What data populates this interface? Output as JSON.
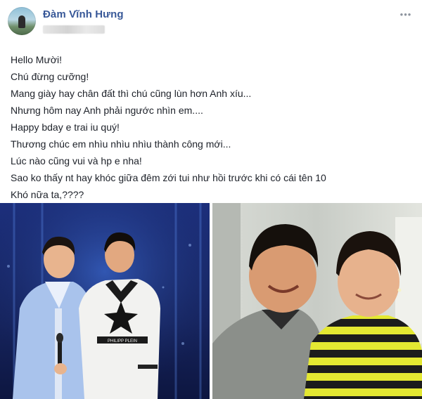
{
  "post": {
    "author": "Đàm Vĩnh Hưng",
    "more_icon": "more-horizontal-icon",
    "lines": [
      "Hello Mười!",
      "Chú đừng cưỡng!",
      "Mang giày hay chân đất thì chú cũng lùn hơn Anh xíu...",
      "Nhưng hôm nay Anh phải ngước nhìn em....",
      "Happy bday e trai iu quý!",
      "Thương chúc em nhìu nhìu nhìu thành công mới...",
      "Lúc nào cũng vui và hp e nha!",
      "Sao ko thấy nt hay khóc giữa đêm zới tui như hồi trước khi có cái tên 10",
      "Khó nữa ta,????"
    ],
    "photos": [
      {
        "shirt_text": "PHILIPP PLEIN"
      },
      {
        "shirt_text": ""
      }
    ]
  },
  "colors": {
    "author_blue": "#385898",
    "text": "#1d2129",
    "muted": "#8d949e"
  }
}
